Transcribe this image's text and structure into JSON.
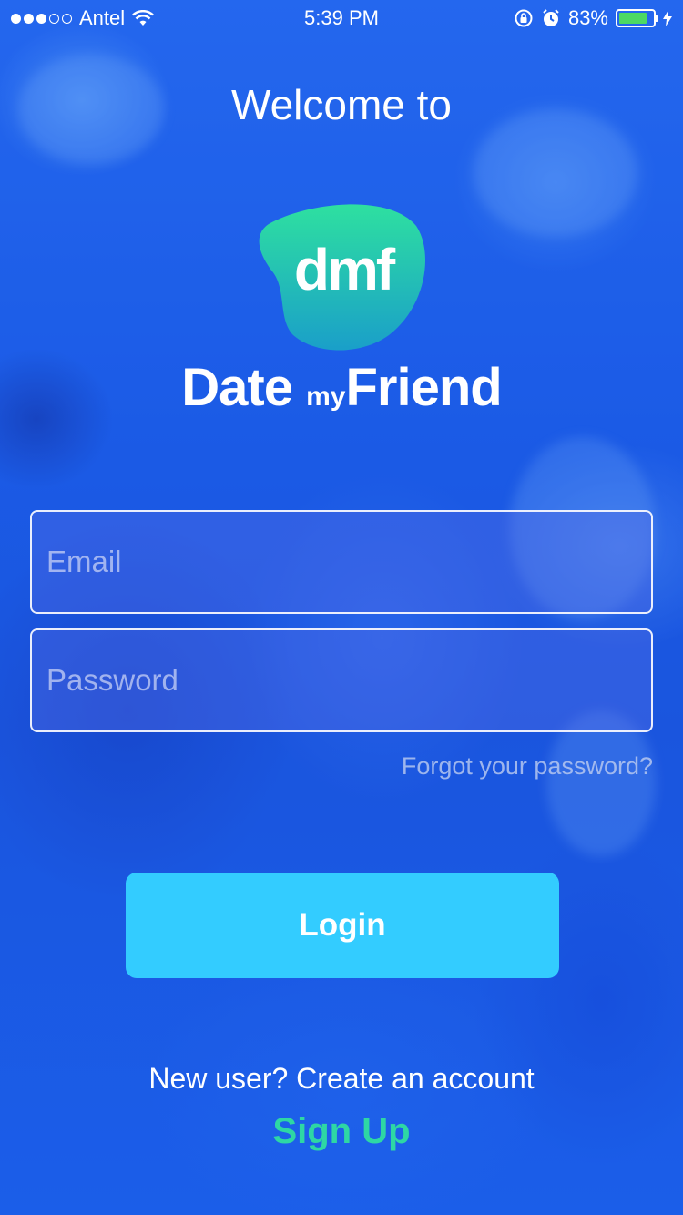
{
  "status_bar": {
    "carrier": "Antel",
    "time": "5:39 PM",
    "battery_percent": "83%",
    "battery_level": 0.83,
    "icons": [
      "signal-dots-icon",
      "wifi-icon",
      "orientation-lock-icon",
      "alarm-icon",
      "battery-icon",
      "charging-bolt-icon"
    ]
  },
  "header": {
    "welcome": "Welcome to"
  },
  "logo": {
    "mark_text": "dmf",
    "brand_part1": "Date",
    "brand_part2": "my",
    "brand_part3": "Friend",
    "colors": {
      "blob_top": "#2ee0a0",
      "blob_bottom": "#1a9fc9"
    }
  },
  "form": {
    "email_placeholder": "Email",
    "email_value": "",
    "password_placeholder": "Password",
    "password_value": "",
    "forgot_label": "Forgot your password?",
    "login_label": "Login"
  },
  "footer": {
    "new_user_text": "New user? Create an account",
    "sign_up_label": "Sign Up"
  },
  "colors": {
    "background": "#1f62e8",
    "login_button": "#33ccff",
    "sign_up_text": "#2ed7a4"
  }
}
